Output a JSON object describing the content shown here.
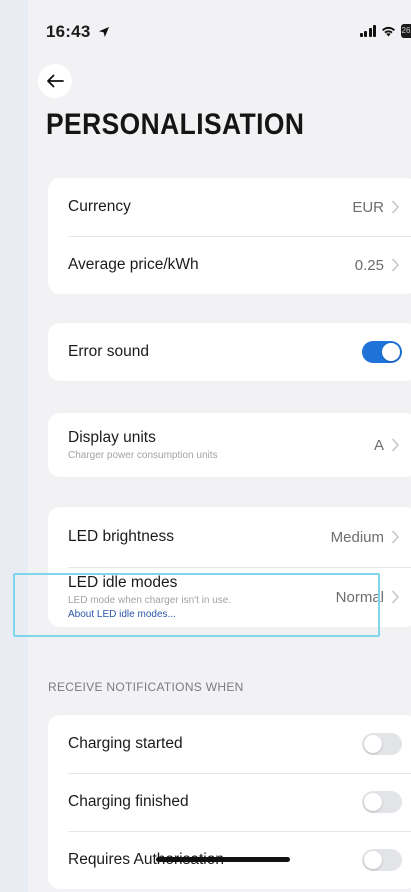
{
  "status_bar": {
    "time": "16:43",
    "battery_level": "26"
  },
  "header": {
    "title": "PERSONALISATION"
  },
  "colors": {
    "accent": "#1f73d8",
    "highlight": "#7ed6ec",
    "link": "#2b56a8"
  },
  "rows": {
    "currency": {
      "label": "Currency",
      "value": "EUR"
    },
    "avg_price": {
      "label": "Average price/kWh",
      "value": "0.25"
    },
    "error_sound": {
      "label": "Error sound",
      "enabled": true
    },
    "display_units": {
      "label": "Display units",
      "subtitle": "Charger power consumption units",
      "value": "A"
    },
    "led_brightness": {
      "label": "LED brightness",
      "value": "Medium"
    },
    "led_idle": {
      "label": "LED idle modes",
      "subtitle": "LED mode when charger isn't in use.",
      "link": "About LED idle modes...",
      "value": "Normal"
    }
  },
  "notifications": {
    "section_title": "RECEIVE NOTIFICATIONS WHEN",
    "items": [
      {
        "label": "Charging started",
        "enabled": false
      },
      {
        "label": "Charging finished",
        "enabled": false
      },
      {
        "label": "Requires Authorisation",
        "enabled": false
      }
    ]
  }
}
